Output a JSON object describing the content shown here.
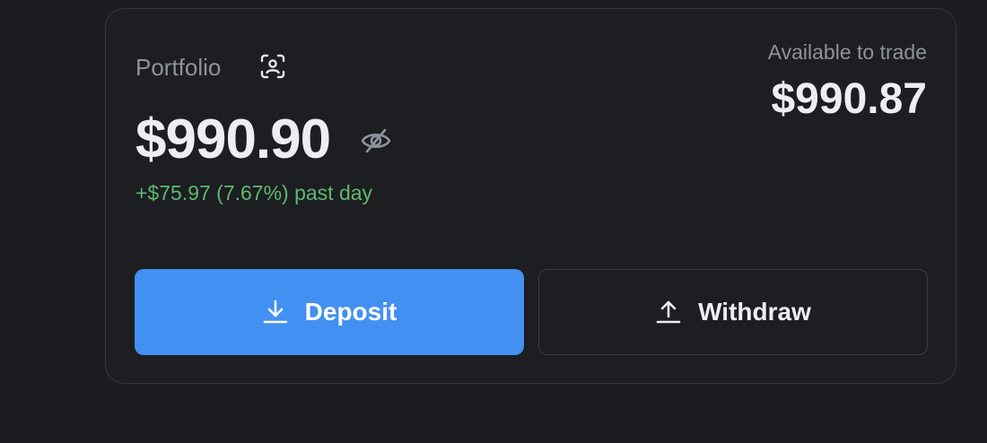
{
  "portfolio": {
    "label": "Portfolio",
    "balance": "$990.90",
    "change": "+$75.97 (7.67%) past day",
    "icons": {
      "profile": "profile-scan-icon",
      "hide": "eye-slash-icon"
    }
  },
  "available": {
    "label": "Available to trade",
    "value": "$990.87"
  },
  "actions": {
    "deposit_label": "Deposit",
    "withdraw_label": "Withdraw",
    "deposit_icon": "download-icon",
    "withdraw_icon": "upload-icon"
  },
  "colors": {
    "background": "#1b1d21",
    "card_border": "#34373d",
    "accent_blue": "#4290f2",
    "positive_green": "#5fb86f",
    "muted_text": "#8e939b",
    "primary_text": "#eceef1"
  }
}
